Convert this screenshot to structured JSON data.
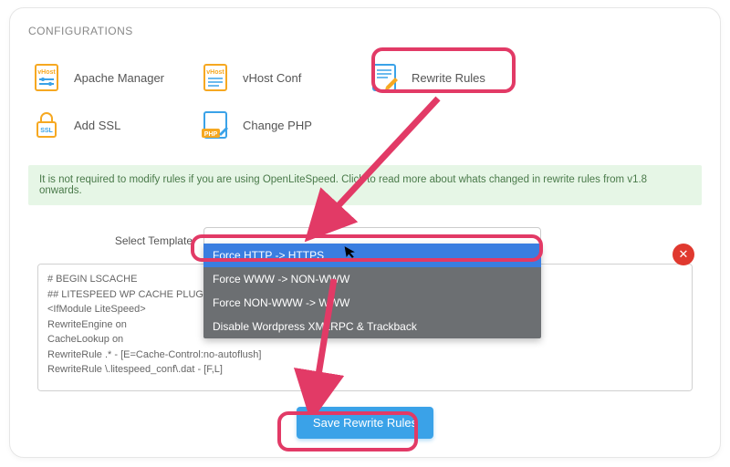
{
  "section_title": "CONFIGURATIONS",
  "tiles": {
    "apache": "Apache Manager",
    "vhost": "vHost Conf",
    "rewrite": "Rewrite Rules",
    "ssl": "Add SSL",
    "php": "Change PHP"
  },
  "info_text": "It is not required to modify rules if you are using OpenLiteSpeed. Click to read more about whats changed in rewrite rules from v1.8 onwards.",
  "template_label": "Select Template",
  "dropdown": {
    "opt1": "Force HTTP -> HTTPS",
    "opt2": "Force WWW -> NON-WWW",
    "opt3": "Force NON-WWW -> WWW",
    "opt4": "Disable Wordpress XMLRPC & Trackback"
  },
  "close_glyph": "✕",
  "editor_text": "# BEGIN LSCACHE\n## LITESPEED WP CACHE PLUGIN - Do\n<IfModule LiteSpeed>\nRewriteEngine on\nCacheLookup on\nRewriteRule .* - [E=Cache-Control:no-autoflush]\nRewriteRule \\.litespeed_conf\\.dat - [F,L]\n\n### marker ASYNC start ###\nRewriteCond %{REQUEST_URI} /wp-admin/admin-ajax\\.pl",
  "save_label": "Save Rewrite Rules"
}
